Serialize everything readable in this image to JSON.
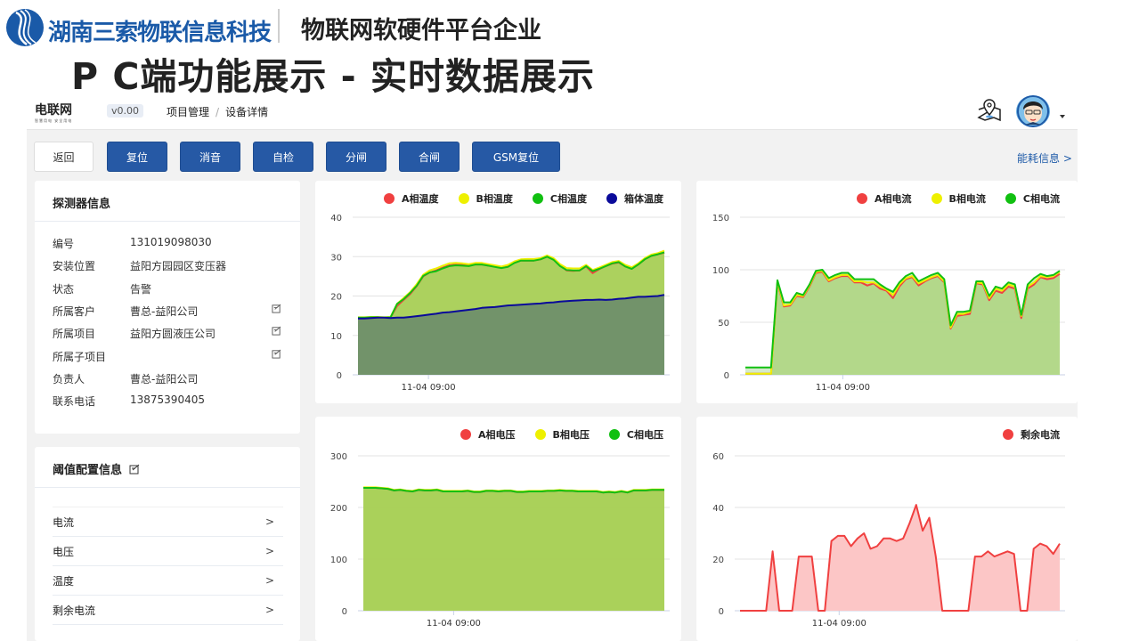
{
  "banner": {
    "company": "湖南三索物联信息科技",
    "slogan": "物联网软硬件平台企业",
    "page_title": "P C端功能展示 - 实时数据展示"
  },
  "topnav": {
    "brand": "电联网",
    "brand_sub": "智慧用电  安全用电",
    "version": "v0.00",
    "breadcrumb": [
      "项目管理",
      "设备详情"
    ],
    "separator": "/"
  },
  "toolbar": {
    "buttons": [
      "返回",
      "复位",
      "消音",
      "自检",
      "分闸",
      "合闸",
      "GSM复位"
    ],
    "energy_link": "能耗信息 >"
  },
  "detector": {
    "title": "探测器信息",
    "fields": [
      {
        "label": "编号",
        "value": "131019098030",
        "editable": false
      },
      {
        "label": "安装位置",
        "value": "益阳方园园区变压器",
        "editable": false
      },
      {
        "label": "状态",
        "value": "告警",
        "editable": false
      },
      {
        "label": "所属客户",
        "value": "曹总-益阳公司",
        "editable": true
      },
      {
        "label": "所属项目",
        "value": "益阳方圆液压公司",
        "editable": true
      },
      {
        "label": "所属子项目",
        "value": "",
        "editable": true
      },
      {
        "label": "负责人",
        "value": "曹总-益阳公司",
        "editable": false
      },
      {
        "label": "联系电话",
        "value": "13875390405",
        "editable": false
      }
    ]
  },
  "threshold": {
    "title": "阈值配置信息",
    "items": [
      "电流",
      "电压",
      "温度",
      "剩余电流"
    ]
  },
  "colors": {
    "primary": "#2659a5",
    "phase_a": "#f04040",
    "phase_b": "#eef000",
    "phase_c": "#11c011",
    "box": "#0a0a9a",
    "area_green": "#a8cf55",
    "area_dark": "#6f8f6a",
    "residual_fill": "#fcc6c6"
  },
  "chart_data": [
    {
      "type": "area",
      "name": "temperature",
      "ylim": [
        0,
        40
      ],
      "yticks": [
        0,
        10,
        20,
        30,
        40
      ],
      "xtick_label": "11-04 09:00",
      "xtick_pos": 0.23,
      "legend_position": "top",
      "series": [
        {
          "name": "A相温度",
          "color": "#f04040",
          "values": [
            14.5,
            14.5,
            14.6,
            14.6,
            14.5,
            14.6,
            17.5,
            19,
            20.5,
            22.5,
            25,
            26,
            26.5,
            27.2,
            27.8,
            28,
            27.9,
            27.7,
            28,
            28,
            27.7,
            27.5,
            27.2,
            27.5,
            28.5,
            29,
            29,
            29,
            29.3,
            30,
            29.3,
            27.8,
            26.5,
            26.4,
            26.5,
            27.5,
            25.8,
            26.8,
            27.6,
            28.2,
            28.5,
            27.5,
            27,
            28,
            29.3,
            30.2,
            30.6,
            31
          ]
        },
        {
          "name": "B相温度",
          "color": "#eef000",
          "values": [
            14.6,
            14.6,
            14.7,
            14.7,
            14.6,
            14.7,
            18,
            19.5,
            21,
            23,
            25.4,
            26.5,
            27,
            27.7,
            28.3,
            28.4,
            28.3,
            28.1,
            28.4,
            28.4,
            28.1,
            27.8,
            27.5,
            27.9,
            28.8,
            29.3,
            29.4,
            29.4,
            29.6,
            30.3,
            29.6,
            28.1,
            27.1,
            27,
            27,
            27.9,
            26.6,
            27.2,
            27.9,
            28.6,
            28.9,
            27.9,
            27.3,
            28.3,
            29.6,
            30.5,
            30.9,
            31.5
          ]
        },
        {
          "name": "C相温度",
          "color": "#11c011",
          "values": [
            14.5,
            14.5,
            14.6,
            14.6,
            14.5,
            14.6,
            18,
            19.2,
            20.8,
            22.6,
            25.1,
            26,
            26.3,
            27,
            27.6,
            27.8,
            27.7,
            27.6,
            28,
            28,
            27.7,
            27.4,
            27.1,
            27.4,
            28.4,
            29,
            29,
            29,
            29.3,
            30,
            29.2,
            27.6,
            26.6,
            26.5,
            26.5,
            27.6,
            26.3,
            26.9,
            27.6,
            28.3,
            28.6,
            27.5,
            26.9,
            28,
            29.3,
            30.2,
            30.6,
            31.1
          ]
        },
        {
          "name": "箱体温度",
          "color": "#0a0a9a",
          "values": [
            14.3,
            14.3,
            14.4,
            14.5,
            14.5,
            14.4,
            14.5,
            14.5,
            14.7,
            14.9,
            15.1,
            15.3,
            15.5,
            15.8,
            15.9,
            16.1,
            16.3,
            16.5,
            16.7,
            17,
            17.1,
            17.2,
            17.4,
            17.6,
            17.7,
            17.8,
            17.9,
            18,
            18.1,
            18.3,
            18.4,
            18.6,
            18.7,
            18.8,
            18.9,
            19,
            19,
            19.1,
            19,
            19.1,
            19.3,
            19.4,
            19.6,
            19.8,
            19.8,
            19.9,
            20,
            20.3
          ]
        }
      ]
    },
    {
      "type": "area",
      "name": "current",
      "ylim": [
        0,
        150
      ],
      "yticks": [
        0,
        50,
        100,
        150
      ],
      "xtick_label": "11-04 09:00",
      "xtick_pos": 0.31,
      "legend_position": "top-right",
      "series": [
        {
          "name": "A相电流",
          "color": "#f04040",
          "values": [
            1,
            1,
            1,
            1,
            1,
            88,
            65,
            66,
            75,
            74,
            84,
            97,
            98,
            89,
            92,
            94,
            94,
            88,
            88,
            85,
            87,
            82,
            80,
            73,
            84,
            91,
            93,
            85,
            89,
            92,
            94,
            88,
            44,
            56,
            57,
            58,
            87,
            86,
            71,
            80,
            78,
            84,
            82,
            54,
            82,
            86,
            93,
            91,
            92,
            96
          ]
        },
        {
          "name": "B相电流",
          "color": "#eef000",
          "values": [
            1,
            1,
            1,
            1,
            1,
            89,
            66,
            67,
            76,
            75,
            85,
            98,
            99,
            90,
            93,
            95,
            95,
            89,
            89,
            88,
            88,
            84,
            81,
            76,
            86,
            92,
            94,
            87,
            90,
            93,
            95,
            89,
            45,
            58,
            58,
            60,
            88,
            87,
            73,
            82,
            80,
            86,
            84,
            56,
            84,
            88,
            94,
            93,
            94,
            98
          ]
        },
        {
          "name": "C相电流",
          "color": "#11c011",
          "values": [
            7,
            7,
            7,
            7,
            7,
            90,
            69,
            69,
            78,
            76,
            86,
            99,
            100,
            92,
            95,
            97,
            97,
            91,
            91,
            91,
            91,
            86,
            82,
            79,
            88,
            94,
            97,
            89,
            92,
            95,
            97,
            91,
            47,
            60,
            60,
            61,
            89,
            89,
            75,
            84,
            82,
            88,
            86,
            57,
            86,
            92,
            96,
            94,
            95,
            99
          ]
        }
      ]
    },
    {
      "type": "area",
      "name": "voltage",
      "ylim": [
        0,
        300
      ],
      "yticks": [
        0,
        100,
        200,
        300
      ],
      "xtick_label": "11-04 09:00",
      "xtick_pos": 0.3,
      "legend_position": "top-right",
      "series": [
        {
          "name": "A相电压",
          "color": "#f04040",
          "values": [
            238,
            238,
            238,
            237,
            236,
            233,
            234,
            232,
            231,
            234,
            233,
            233,
            234,
            231,
            231,
            231,
            231,
            232,
            230,
            230,
            232,
            232,
            231,
            232,
            232,
            230,
            230,
            231,
            231,
            231,
            232,
            232,
            233,
            232,
            232,
            231,
            231,
            231,
            231,
            229,
            230,
            229,
            231,
            229,
            233,
            233,
            233,
            234,
            234,
            234
          ]
        },
        {
          "name": "B相电压",
          "color": "#eef000",
          "values": [
            239,
            239,
            239,
            238,
            237,
            234,
            235,
            233,
            232,
            235,
            234,
            234,
            235,
            232,
            232,
            232,
            232,
            233,
            231,
            231,
            233,
            233,
            232,
            233,
            233,
            231,
            231,
            232,
            232,
            232,
            233,
            233,
            234,
            233,
            233,
            232,
            232,
            232,
            232,
            230,
            231,
            230,
            232,
            230,
            234,
            234,
            234,
            235,
            235,
            235
          ]
        },
        {
          "name": "C相电压",
          "color": "#11c011",
          "values": [
            238,
            238,
            238,
            237,
            236,
            233,
            234,
            232,
            231,
            234,
            233,
            233,
            234,
            231,
            231,
            231,
            231,
            232,
            230,
            230,
            232,
            232,
            231,
            232,
            232,
            230,
            230,
            231,
            231,
            231,
            232,
            232,
            233,
            232,
            232,
            231,
            231,
            231,
            231,
            229,
            230,
            229,
            231,
            229,
            233,
            233,
            233,
            234,
            234,
            234
          ]
        }
      ]
    },
    {
      "type": "area",
      "name": "residual",
      "ylim": [
        0,
        60
      ],
      "yticks": [
        0,
        20,
        40,
        60
      ],
      "xtick_label": "11-04 09:00",
      "xtick_pos": 0.31,
      "legend_position": "top-right",
      "series": [
        {
          "name": "剩余电流",
          "color": "#f04040",
          "values": [
            0,
            0,
            0,
            0,
            0,
            23,
            0,
            0,
            0,
            21,
            21,
            21,
            0,
            0,
            27,
            29,
            29,
            25,
            28,
            30,
            24,
            25,
            28,
            28,
            27,
            28,
            34,
            41,
            31,
            36,
            21,
            0,
            0,
            0,
            0,
            0,
            21,
            21,
            23,
            21,
            22,
            23,
            22,
            0,
            0,
            24,
            26,
            25,
            22,
            26
          ]
        }
      ]
    }
  ]
}
